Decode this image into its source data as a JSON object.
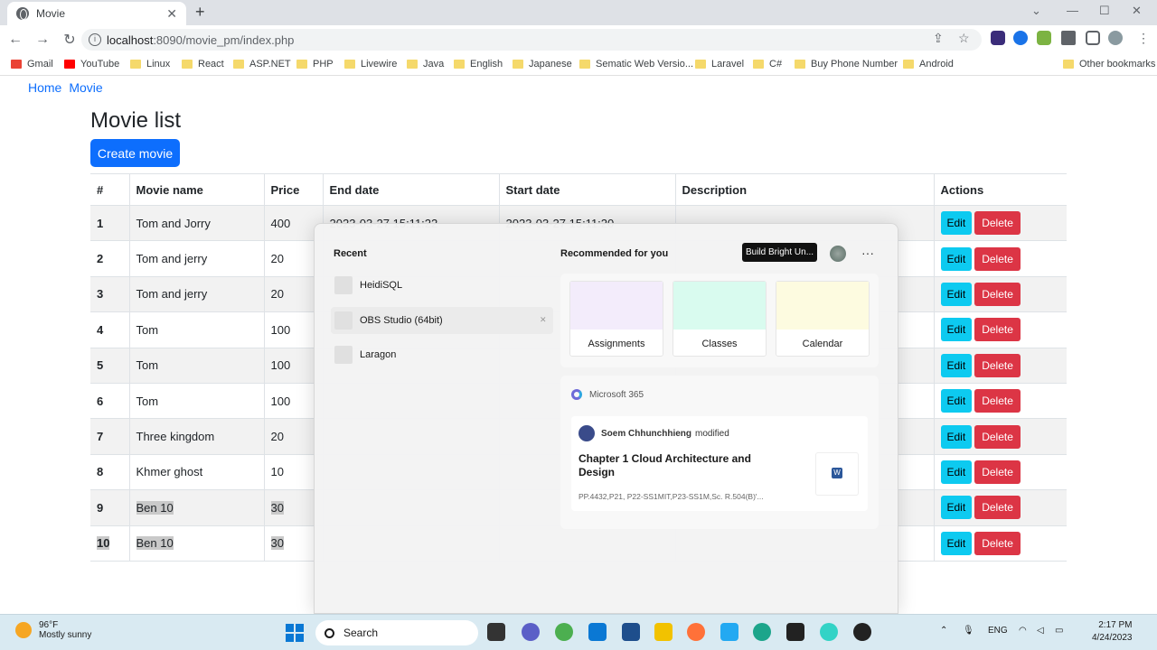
{
  "browser": {
    "tab_title": "Movie",
    "url_host": "localhost",
    "url_path": ":8090/movie_pm/index.php",
    "bookmarks": [
      "Gmail",
      "YouTube",
      "Linux",
      "React",
      "ASP.NET",
      "PHP",
      "Livewire",
      "Java",
      "English",
      "Japanese",
      "Sematic Web Versio...",
      "Laravel",
      "C#",
      "Buy Phone Number",
      "Android"
    ],
    "other_bookmarks": "Other bookmarks"
  },
  "page": {
    "breadcrumb": [
      "Home",
      "Movie"
    ],
    "title": "Movie list",
    "create_button": "Create movie",
    "columns": [
      "#",
      "Movie name",
      "Price",
      "End date",
      "Start date",
      "Description",
      "Actions"
    ],
    "edit_label": "Edit",
    "delete_label": "Delete",
    "rows": [
      {
        "id": "1",
        "name": "Tom and Jorry",
        "price": "400",
        "end": "2023-03-27 15:11:22",
        "start": "2023-03-27 15:11:20",
        "desc": ""
      },
      {
        "id": "2",
        "name": "Tom and jerry",
        "price": "20",
        "end": "",
        "start": "",
        "desc": ""
      },
      {
        "id": "3",
        "name": "Tom and jerry",
        "price": "20",
        "end": "",
        "start": "",
        "desc": ""
      },
      {
        "id": "4",
        "name": "Tom",
        "price": "100",
        "end": "",
        "start": "",
        "desc": ""
      },
      {
        "id": "5",
        "name": "Tom",
        "price": "100",
        "end": "",
        "start": "",
        "desc": ""
      },
      {
        "id": "6",
        "name": "Tom",
        "price": "100",
        "end": "",
        "start": "",
        "desc": ""
      },
      {
        "id": "7",
        "name": "Three kingdom",
        "price": "20",
        "end": "",
        "start": "",
        "desc": ""
      },
      {
        "id": "8",
        "name": "Khmer ghost",
        "price": "10",
        "end": "",
        "start": "",
        "desc": ""
      },
      {
        "id": "9",
        "name": "Ben 10",
        "price": "30",
        "end": "",
        "start": "",
        "desc": ""
      },
      {
        "id": "10",
        "name": "Ben 10",
        "price": "30",
        "end": "",
        "start": "",
        "desc": ""
      }
    ]
  },
  "start_menu": {
    "recent_heading": "Recent",
    "recent": [
      "HeidiSQL",
      "OBS Studio (64bit)",
      "Laragon"
    ],
    "recommended_heading": "Recommended for you",
    "tooltip": "Build Bright Un...",
    "cards": [
      "Assignments",
      "Classes",
      "Calendar"
    ],
    "card_colors": [
      "#f3ecfb",
      "#d9fbef",
      "#fdfbe0"
    ],
    "m365_label": "Microsoft 365",
    "doc_user": "Soem Chhunchhieng",
    "doc_action": "modified",
    "doc_title": "Chapter 1 Cloud Architecture and Design",
    "doc_path": "PP.4432,P21, P22-SS1MIT,P23-SS1M,Sc. R.504(B)'..."
  },
  "taskbar": {
    "temp": "96°F",
    "weather": "Mostly sunny",
    "search": "Search",
    "lang": "ENG",
    "time": "2:17 PM",
    "date": "4/24/2023"
  }
}
